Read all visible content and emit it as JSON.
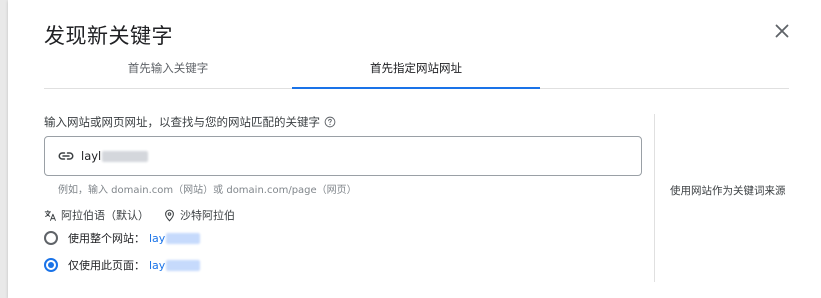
{
  "dialog": {
    "title": "发现新关键字",
    "close_icon": "close-icon"
  },
  "tabs": [
    {
      "label": "首先输入关键字",
      "active": false
    },
    {
      "label": "首先指定网站网址",
      "active": true
    }
  ],
  "main": {
    "prompt": "输入网站或网页网址，以查找与您的网站匹配的关键字",
    "url_input": {
      "value": "layl",
      "icon": "link-icon"
    },
    "hint": "例如，输入 domain.com（网站）或 domain.com/page（网页）",
    "language": "阿拉伯语（默认）",
    "location": "沙特阿拉伯",
    "radios": [
      {
        "label": "使用整个网站：",
        "url": "lay",
        "checked": false
      },
      {
        "label": "仅使用此页面：",
        "url": "lay",
        "checked": true
      }
    ]
  },
  "side": {
    "text": "使用网站作为关键词来源"
  },
  "colors": {
    "accent": "#1a73e8",
    "text": "#202124",
    "muted": "#80868b"
  }
}
